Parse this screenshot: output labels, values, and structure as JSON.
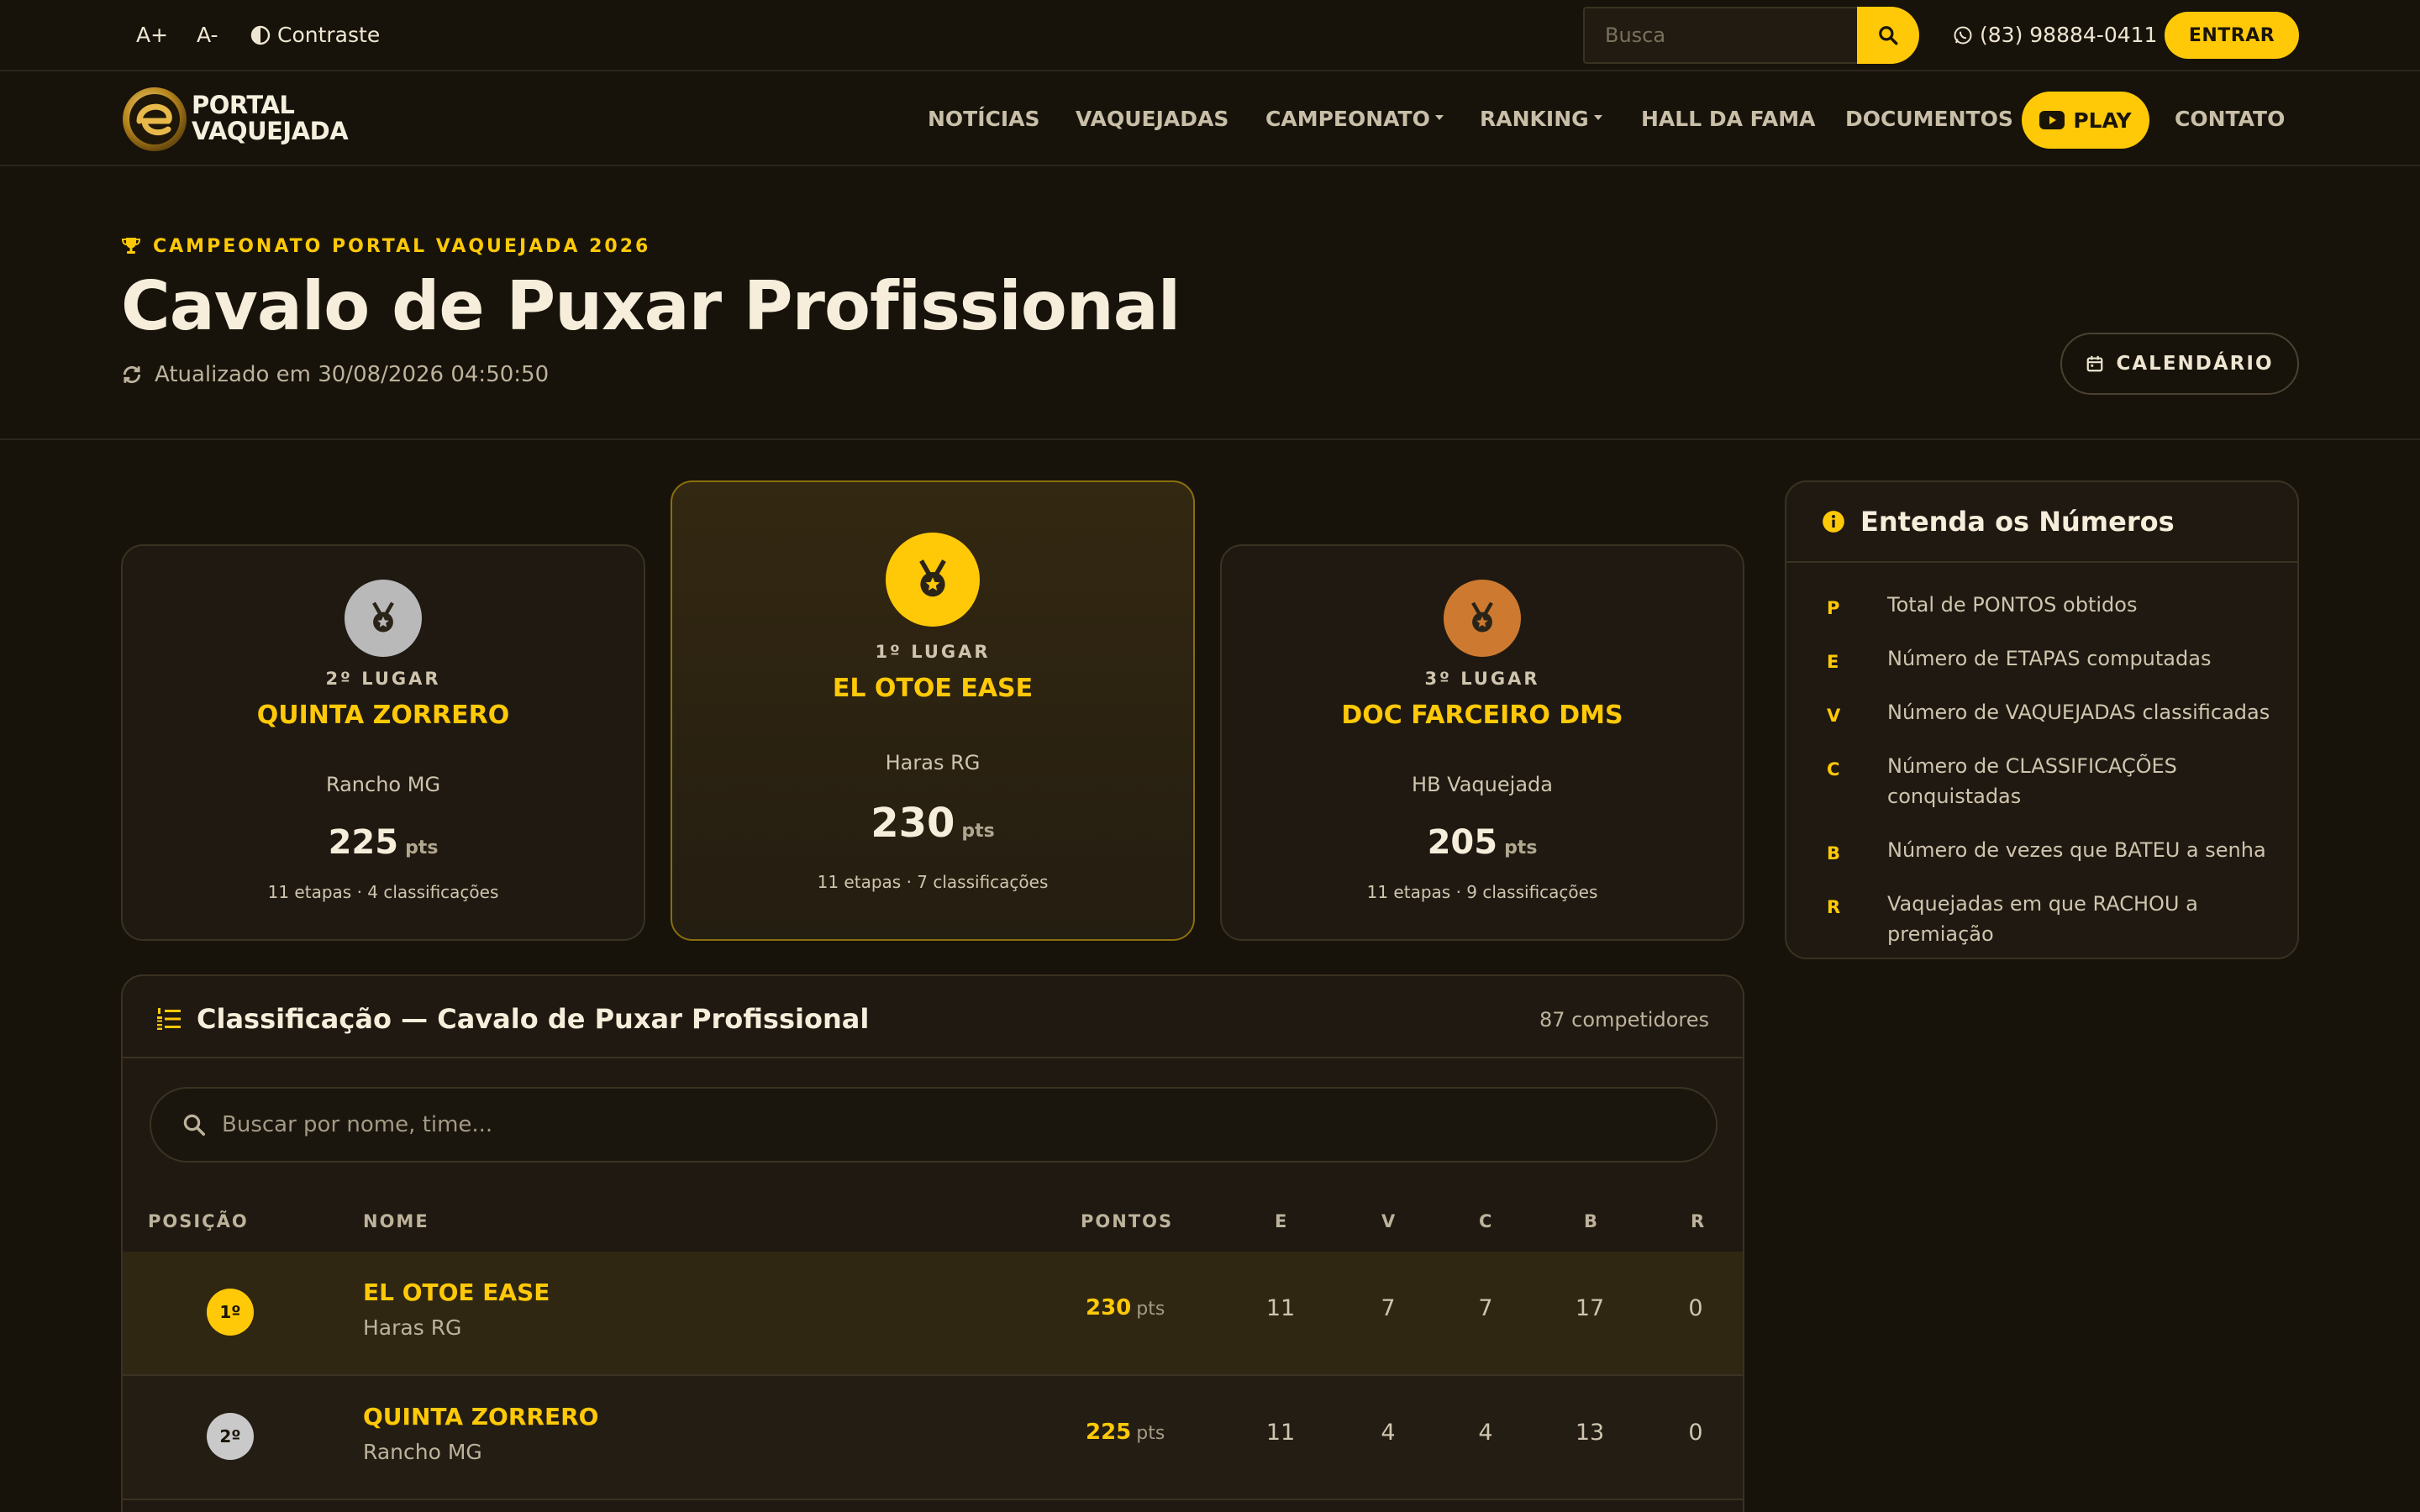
{
  "topbar": {
    "font_increase": "A+",
    "font_decrease": "A-",
    "contrast_label": "Contraste",
    "search_placeholder": "Busca",
    "phone": "(83) 98884-0411",
    "login_label": "ENTRAR"
  },
  "brand": {
    "logo_line1": "PORTAL",
    "logo_line2": "VAQUEJADA",
    "accent_color": "#ffc907"
  },
  "nav": {
    "items": [
      {
        "label": "NOTÍCIAS"
      },
      {
        "label": "VAQUEJADAS"
      },
      {
        "label": "CAMPEONATO"
      },
      {
        "label": "RANKING"
      },
      {
        "label": "HALL DA FAMA"
      },
      {
        "label": "DOCUMENTOS"
      },
      {
        "label": "PLAY"
      },
      {
        "label": "CONTATO"
      }
    ]
  },
  "header": {
    "kicker": "CAMPEONATO PORTAL VAQUEJADA 2026",
    "title": "Cavalo de Puxar Profissional",
    "updated": "Atualizado em 30/08/2026 04:50:50",
    "calendar_label": "CALENDÁRIO"
  },
  "podium": [
    {
      "position_label": "2º LUGAR",
      "name": "QUINTA ZORRERO",
      "team": "Rancho MG",
      "points": "225",
      "points_unit": "pts",
      "stats": "11 etapas · 4 classificações",
      "medal_color": "#b9b9b9"
    },
    {
      "position_label": "1º LUGAR",
      "name": "EL OTOE EASE",
      "team": "Haras RG",
      "points": "230",
      "points_unit": "pts",
      "stats": "11 etapas · 7 classificações",
      "medal_color": "#ffc907"
    },
    {
      "position_label": "3º LUGAR",
      "name": "DOC FARCEIRO DMS",
      "team": "HB Vaquejada",
      "points": "205",
      "points_unit": "pts",
      "stats": "11 etapas · 9 classificações",
      "medal_color": "#cd7a30"
    }
  ],
  "legend": {
    "title": "Entenda os Números",
    "items": [
      {
        "key": "P",
        "text": "Total de PONTOS obtidos"
      },
      {
        "key": "E",
        "text": "Número de ETAPAS computadas"
      },
      {
        "key": "V",
        "text": "Número de VAQUEJADAS classificadas"
      },
      {
        "key": "C",
        "text": "Número de CLASSIFICAÇÕES conquistadas"
      },
      {
        "key": "B",
        "text": "Número de vezes que BATEU a senha"
      },
      {
        "key": "R",
        "text": "Vaquejadas em que RACHOU a premiação"
      }
    ]
  },
  "ranking": {
    "title": "Classificação — Cavalo de Puxar Profissional",
    "count": "87 competidores",
    "search_placeholder": "Buscar por nome, time...",
    "columns": [
      "POSIÇÃO",
      "NOME",
      "PONTOS",
      "E",
      "V",
      "C",
      "B",
      "R"
    ],
    "rows": [
      {
        "position": "1º",
        "name": "EL OTOE EASE",
        "team": "Haras RG",
        "points": "230",
        "points_unit": "pts",
        "E": "11",
        "V": "7",
        "C": "7",
        "B": "17",
        "R": "0",
        "badge_color": "#ffc907"
      },
      {
        "position": "2º",
        "name": "QUINTA ZORRERO",
        "team": "Rancho MG",
        "points": "225",
        "points_unit": "pts",
        "E": "11",
        "V": "4",
        "C": "4",
        "B": "13",
        "R": "0",
        "badge_color": "#c9c9c9"
      }
    ]
  }
}
